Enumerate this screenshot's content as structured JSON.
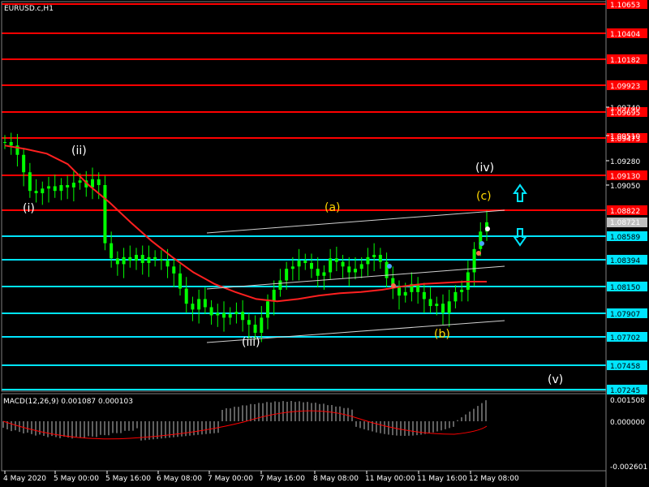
{
  "chart_title": "EURUSD.c,H1",
  "macd_title": "MACD(12,26,9) 0.001087 0.000103",
  "colors": {
    "background": "#000000",
    "candle": "#00ff00",
    "ma": "#ff2020",
    "red_level": "#ff0000",
    "cyan_level": "#00e5ff",
    "trendline": "#d0d0d0",
    "wave_white": "#ffffff",
    "wave_yellow": "#ffd700",
    "arrow": "#00e5ff",
    "axis_text": "#ffffff",
    "grid": "#808080"
  },
  "price_levels": [
    {
      "label": "1.10653",
      "color": "red"
    },
    {
      "label": "1.10404",
      "color": "red"
    },
    {
      "label": "1.10182",
      "color": "red"
    },
    {
      "label": "1.09923",
      "color": "red"
    },
    {
      "label": "1.09695",
      "color": "red"
    },
    {
      "label": "1.09473",
      "color": "red"
    },
    {
      "label": "1.09130",
      "color": "red"
    },
    {
      "label": "1.08822",
      "color": "red"
    },
    {
      "label": "1.08589",
      "color": "cyan"
    },
    {
      "label": "1.08394",
      "color": "cyan"
    },
    {
      "label": "1.08150",
      "color": "cyan"
    },
    {
      "label": "1.07907",
      "color": "cyan"
    },
    {
      "label": "1.07702",
      "color": "cyan"
    },
    {
      "label": "1.07458",
      "color": "cyan"
    },
    {
      "label": "1.07245",
      "color": "cyan"
    }
  ],
  "axis_ticks": [
    "1.09740",
    "1.09510",
    "1.09280",
    "1.09050"
  ],
  "current_price": "1.08721",
  "macd_ticks": [
    "0.001508",
    "0.000000",
    "-0.002601"
  ],
  "x_ticks": [
    "4 May 2020",
    "5 May 00:00",
    "5 May 16:00",
    "6 May 08:00",
    "7 May 00:00",
    "7 May 16:00",
    "8 May 08:00",
    "11 May 00:00",
    "11 May 16:00",
    "12 May 08:00"
  ],
  "wave_labels": [
    {
      "text": "(i)",
      "color": "white"
    },
    {
      "text": "(ii)",
      "color": "white"
    },
    {
      "text": "(iii)",
      "color": "white"
    },
    {
      "text": "(iv)",
      "color": "white"
    },
    {
      "text": "(v)",
      "color": "white"
    },
    {
      "text": "(a)",
      "color": "yellow"
    },
    {
      "text": "(b)",
      "color": "yellow"
    },
    {
      "text": "(c)",
      "color": "yellow"
    }
  ],
  "arrows": [
    {
      "icon": "up-arrow-icon"
    },
    {
      "icon": "down-arrow-icon"
    }
  ],
  "chart_data": {
    "type": "candlestick",
    "symbol": "EURUSD.c",
    "timeframe": "H1",
    "y_range": [
      1.0722,
      1.0668
    ],
    "ohlc_closes": [
      1.0947,
      1.0944,
      1.0936,
      1.0921,
      1.0905,
      1.0903,
      1.0907,
      1.0909,
      1.0905,
      1.091,
      1.0908,
      1.0912,
      1.0914,
      1.0908,
      1.0915,
      1.091,
      1.086,
      1.0847,
      1.0842,
      1.0848,
      1.0845,
      1.085,
      1.0843,
      1.0848,
      1.0846,
      1.0845,
      1.084,
      1.0834,
      1.0821,
      1.0808,
      1.0803,
      1.0812,
      1.0805,
      1.0798,
      1.08,
      1.0796,
      1.0799,
      1.0801,
      1.0794,
      1.079,
      1.0783,
      1.0796,
      1.081,
      1.082,
      1.0828,
      1.0838,
      1.084,
      1.0845,
      1.0843,
      1.0838,
      1.0832,
      1.0835,
      1.0847,
      1.0844,
      1.084,
      1.0835,
      1.0838,
      1.0842,
      1.0848,
      1.085,
      1.0844,
      1.083,
      1.0822,
      1.0815,
      1.0818,
      1.0825,
      1.0818,
      1.0812,
      1.0806,
      1.0808,
      1.08,
      1.081,
      1.0818,
      1.082,
      1.0835,
      1.0855,
      1.087,
      1.0878
    ],
    "ma_line": [
      1.0944,
      1.0941,
      1.0937,
      1.0928,
      1.091,
      1.0895,
      1.0878,
      1.0862,
      1.0848,
      1.0835,
      1.0825,
      1.0818,
      1.0812,
      1.081,
      1.0812,
      1.0815,
      1.0817,
      1.0818,
      1.082,
      1.0823,
      1.0825,
      1.0826,
      1.0827,
      1.0827
    ]
  }
}
